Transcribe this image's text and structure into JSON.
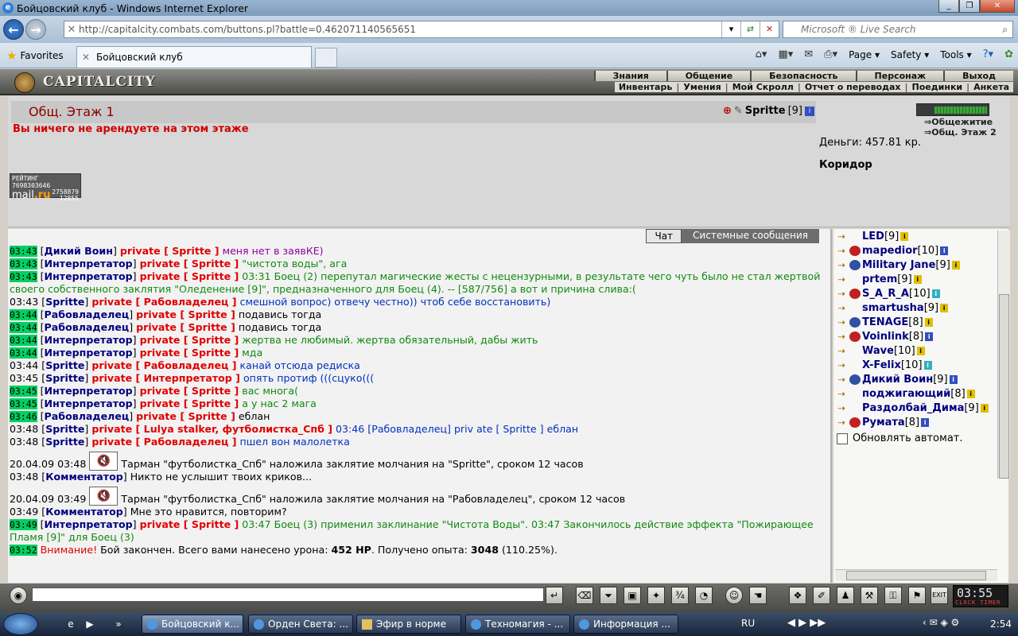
{
  "window": {
    "title": "Бойцовский клуб - Windows Internet Explorer"
  },
  "browser": {
    "url": "http://capitalcity.combats.com/buttons.pl?battle=0.462071140565651",
    "search_placeholder": "Microsoft ® Live Search",
    "favorites": "Favorites",
    "tab_title": "Бойцовский клуб",
    "cmd": {
      "page": "Page",
      "safety": "Safety",
      "tools": "Tools"
    }
  },
  "game": {
    "logo": "CAPITALCITY",
    "menu1": [
      "Знания",
      "Общение",
      "Безопасность",
      "Персонаж",
      "Выход"
    ],
    "menu2": [
      "Инвентарь",
      "Умения",
      "Мой Скролл",
      "Отчет о переводах",
      "Поединки",
      "Анкета"
    ],
    "room_title": "Общ. Этаж 1",
    "player_name": "Spritte",
    "player_level": "[9]",
    "warning": "Вы ничего не арендуете на этом этаже",
    "money": "Деньги: 457.81 кр.",
    "location": "Коридор",
    "links": [
      "Общежитие",
      "Общ. Этаж 2"
    ],
    "counter": {
      "top": "РЕЙТИНГ 7698303646",
      "n1": "2758879",
      "n2": "12855",
      "brand_mail": "mail",
      "brand_ru": ".ru"
    }
  },
  "chat": {
    "tab_chat": "Чат",
    "tab_system": "Системные сообщения",
    "lines": [
      {
        "ts": "03:43",
        "hl": true,
        "who": "Дикий Воин",
        "to": "private [ Spritte ]",
        "text": "меня нет в заявКЕ)",
        "cls": "msg-purple"
      },
      {
        "ts": "03:43",
        "hl": true,
        "who": "Интерпретатор",
        "to": "private [ Spritte ]",
        "text": "\"чистота воды\", ага",
        "cls": "msg-green"
      },
      {
        "ts": "03:43",
        "hl": true,
        "who": "Интерпретатор",
        "to": "private [ Spritte ]",
        "text": "03:31 Боец (2) перепутал магические жесты с нецензурными, в результате чего чуть было не стал жертвой своего собственного заклятия \"Оледенение [9]\", предназначенного для Боец (4). -- [587/756] а вот и причина слива:(",
        "cls": "msg-green",
        "wrap": true
      },
      {
        "ts": "03:43",
        "hl": false,
        "who": "Spritte",
        "to": "private [ Рабовладелец ]",
        "text": "смешной вопрос) отвечу честно)) чтоб себе восстановить)",
        "cls": "msg-blue"
      },
      {
        "ts": "03:44",
        "hl": true,
        "who": "Рабовладелец",
        "to": "private [ Spritte ]",
        "text": "подавись тогда",
        "cls": ""
      },
      {
        "ts": "03:44",
        "hl": true,
        "who": "Рабовладелец",
        "to": "private [ Spritte ]",
        "text": "подавись тогда",
        "cls": ""
      },
      {
        "ts": "03:44",
        "hl": true,
        "who": "Интерпретатор",
        "to": "private [ Spritte ]",
        "text": "жертва не любимый. жертва обязательный, дабы жить",
        "cls": "msg-green"
      },
      {
        "ts": "03:44",
        "hl": true,
        "who": "Интерпретатор",
        "to": "private [ Spritte ]",
        "text": "мда",
        "cls": "msg-green"
      },
      {
        "ts": "03:44",
        "hl": false,
        "who": "Spritte",
        "to": "private [ Рабовладелец ]",
        "text": "канай отсюда редиска",
        "cls": "msg-blue"
      },
      {
        "ts": "03:45",
        "hl": false,
        "who": "Spritte",
        "to": "private [ Интерпретатор ]",
        "text": "опять протиф (((сцуко(((",
        "cls": "msg-blue"
      },
      {
        "ts": "03:45",
        "hl": true,
        "who": "Интерпретатор",
        "to": "private [ Spritte ]",
        "text": "вас многа(",
        "cls": "msg-green"
      },
      {
        "ts": "03:45",
        "hl": true,
        "who": "Интерпретатор",
        "to": "private [ Spritte ]",
        "text": "а у нас 2 мага",
        "cls": "msg-green"
      },
      {
        "ts": "03:46",
        "hl": true,
        "who": "Рабовладелец",
        "to": "private [ Spritte ]",
        "text": "еблан",
        "cls": ""
      },
      {
        "ts": "03:48",
        "hl": false,
        "who": "Spritte",
        "to": "private [ Lulya stalker, футболистка_Спб ]",
        "text": "03:46 [Рабовладелец] priv ate [ Spritte ] еблан",
        "cls": "msg-blue"
      },
      {
        "ts": "03:48",
        "hl": false,
        "who": "Spritte",
        "to": "private [ Рабовладелец ]",
        "text": "пшел вон малолетка",
        "cls": "msg-blue"
      }
    ],
    "sys1": {
      "ts": "20.04.09 03:48",
      "text": "Тарман \"футболистка_Спб\" наложила заклятие молчания на \"Spritte\", сроком 12 часов"
    },
    "com1": {
      "ts": "03:48",
      "who": "Комментатор",
      "text": "Никто не услышит твоих криков..."
    },
    "sys2": {
      "ts": "20.04.09 03:49",
      "text": "Тарман \"футболистка_Спб\" наложила заклятие молчания на \"Рабовладелец\", сроком 12 часов"
    },
    "com2": {
      "ts": "03:49",
      "who": "Комментатор",
      "text": "Мне это нравится, повторим?"
    },
    "last_interp": {
      "ts": "03:49",
      "who": "Интерпретатор",
      "to": "private [ Spritte ]",
      "text": "03:47 Боец (3) применил заклинание \"Чистота Воды\". 03:47 Закончилось действие эффекта \"Пожирающее Пламя [9]\" для Боец (3)"
    },
    "final": {
      "ts": "03:52",
      "attn": "Внимание!",
      "p1": "Бой закончен. Всего вами нанесено урона:",
      "dmg": "452 HP",
      "p2": ". Получено опыта:",
      "exp": "3048",
      "p3": "(110.25%)."
    }
  },
  "players": [
    {
      "name": "LED",
      "lvl": "[9]"
    },
    {
      "name": "mapedior",
      "lvl": "[10]"
    },
    {
      "name": "Military Jane",
      "lvl": "[9]"
    },
    {
      "name": "prtem",
      "lvl": "[9]"
    },
    {
      "name": "S_A_R_A",
      "lvl": "[10]"
    },
    {
      "name": "smartusha",
      "lvl": "[9]"
    },
    {
      "name": "TENAGE",
      "lvl": "[8]"
    },
    {
      "name": "Voinlink",
      "lvl": "[8]"
    },
    {
      "name": "Wave",
      "lvl": "[10]"
    },
    {
      "name": "X-Felix",
      "lvl": "[10]"
    },
    {
      "name": "Дикий Воин",
      "lvl": "[9]"
    },
    {
      "name": "поджигающий",
      "lvl": "[8]"
    },
    {
      "name": "Раздолбай_Дима",
      "lvl": "[9]"
    },
    {
      "name": "Румата",
      "lvl": "[8]"
    }
  ],
  "autoupdate": "Обновлять автомат.",
  "clock": {
    "time": "03:55",
    "label": "CLOCK TIMER"
  },
  "taskbar": {
    "tasks": [
      "Бойцовский к...",
      "Орден Света: ...",
      "Эфир в норме",
      "Техномагия - ...",
      "Информация ..."
    ],
    "lang": "RU",
    "time": "2:54"
  }
}
